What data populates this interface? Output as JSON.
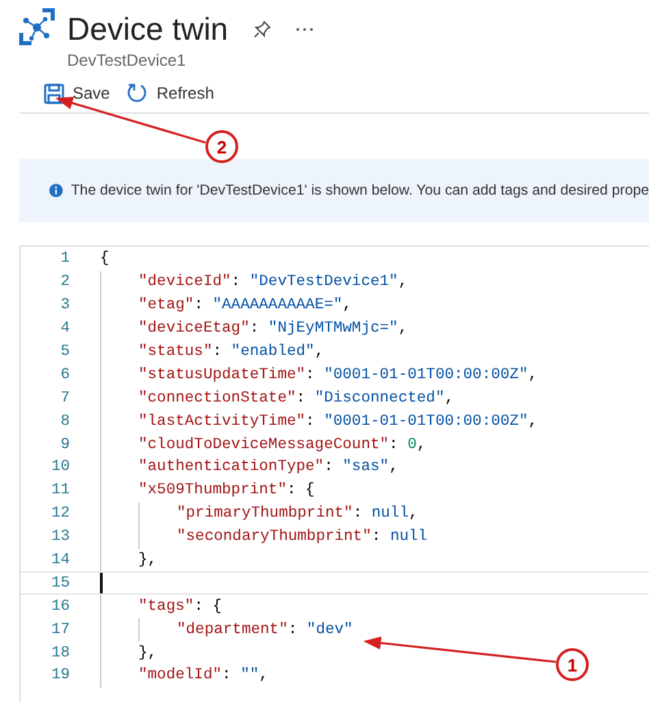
{
  "header": {
    "title": "Device twin",
    "subtitle": "DevTestDevice1"
  },
  "toolbar": [
    {
      "kind": "save",
      "label": "Save"
    },
    {
      "kind": "refresh",
      "label": "Refresh"
    }
  ],
  "info_banner": {
    "text": "The device twin for 'DevTestDevice1' is shown below. You can add tags and desired prope"
  },
  "editor": {
    "lines": [
      {
        "number": "1",
        "current": false,
        "tokens": [
          {
            "kind": "punct",
            "text": "{"
          }
        ],
        "children": [
          {
            "number": "2",
            "current": false,
            "tokens": [
              {
                "kind": "key",
                "text": "\"deviceId\""
              },
              {
                "kind": "punct",
                "text": ": "
              },
              {
                "kind": "string",
                "text": "\"DevTestDevice1\""
              },
              {
                "kind": "punct",
                "text": ","
              }
            ]
          },
          {
            "number": "3",
            "current": false,
            "tokens": [
              {
                "kind": "key",
                "text": "\"etag\""
              },
              {
                "kind": "punct",
                "text": ": "
              },
              {
                "kind": "string",
                "text": "\"AAAAAAAAAAE=\""
              },
              {
                "kind": "punct",
                "text": ","
              }
            ]
          },
          {
            "number": "4",
            "current": false,
            "tokens": [
              {
                "kind": "key",
                "text": "\"deviceEtag\""
              },
              {
                "kind": "punct",
                "text": ": "
              },
              {
                "kind": "string",
                "text": "\"NjEyMTMwMjc=\""
              },
              {
                "kind": "punct",
                "text": ","
              }
            ]
          },
          {
            "number": "5",
            "current": false,
            "tokens": [
              {
                "kind": "key",
                "text": "\"status\""
              },
              {
                "kind": "punct",
                "text": ": "
              },
              {
                "kind": "string",
                "text": "\"enabled\""
              },
              {
                "kind": "punct",
                "text": ","
              }
            ]
          },
          {
            "number": "6",
            "current": false,
            "tokens": [
              {
                "kind": "key",
                "text": "\"statusUpdateTime\""
              },
              {
                "kind": "punct",
                "text": ": "
              },
              {
                "kind": "string",
                "text": "\"0001-01-01T00:00:00Z\""
              },
              {
                "kind": "punct",
                "text": ","
              }
            ]
          },
          {
            "number": "7",
            "current": false,
            "tokens": [
              {
                "kind": "key",
                "text": "\"connectionState\""
              },
              {
                "kind": "punct",
                "text": ": "
              },
              {
                "kind": "string",
                "text": "\"Disconnected\""
              },
              {
                "kind": "punct",
                "text": ","
              }
            ]
          },
          {
            "number": "8",
            "current": false,
            "tokens": [
              {
                "kind": "key",
                "text": "\"lastActivityTime\""
              },
              {
                "kind": "punct",
                "text": ": "
              },
              {
                "kind": "string",
                "text": "\"0001-01-01T00:00:00Z\""
              },
              {
                "kind": "punct",
                "text": ","
              }
            ]
          },
          {
            "number": "9",
            "current": false,
            "tokens": [
              {
                "kind": "key",
                "text": "\"cloudToDeviceMessageCount\""
              },
              {
                "kind": "punct",
                "text": ": "
              },
              {
                "kind": "number",
                "text": "0"
              },
              {
                "kind": "punct",
                "text": ","
              }
            ]
          },
          {
            "number": "10",
            "current": false,
            "tokens": [
              {
                "kind": "key",
                "text": "\"authenticationType\""
              },
              {
                "kind": "punct",
                "text": ": "
              },
              {
                "kind": "string",
                "text": "\"sas\""
              },
              {
                "kind": "punct",
                "text": ","
              }
            ]
          },
          {
            "number": "11",
            "current": false,
            "tokens": [
              {
                "kind": "key",
                "text": "\"x509Thumbprint\""
              },
              {
                "kind": "punct",
                "text": ": {"
              }
            ],
            "children": [
              {
                "number": "12",
                "current": false,
                "tokens": [
                  {
                    "kind": "key",
                    "text": "\"primaryThumbprint\""
                  },
                  {
                    "kind": "punct",
                    "text": ": "
                  },
                  {
                    "kind": "null",
                    "text": "null"
                  },
                  {
                    "kind": "punct",
                    "text": ","
                  }
                ]
              },
              {
                "number": "13",
                "current": false,
                "tokens": [
                  {
                    "kind": "key",
                    "text": "\"secondaryThumbprint\""
                  },
                  {
                    "kind": "punct",
                    "text": ": "
                  },
                  {
                    "kind": "null",
                    "text": "null"
                  }
                ]
              }
            ]
          },
          {
            "number": "14",
            "current": false,
            "tokens": [
              {
                "kind": "punct",
                "text": "},"
              }
            ]
          },
          {
            "number": "15",
            "current": true
          },
          {
            "number": "16",
            "current": false,
            "tokens": [
              {
                "kind": "key",
                "text": "\"tags\""
              },
              {
                "kind": "punct",
                "text": ": {"
              }
            ],
            "children": [
              {
                "number": "17",
                "current": false,
                "tokens": [
                  {
                    "kind": "key",
                    "text": "\"department\""
                  },
                  {
                    "kind": "punct",
                    "text": ": "
                  },
                  {
                    "kind": "string",
                    "text": "\"dev\""
                  }
                ]
              }
            ]
          },
          {
            "number": "18",
            "current": false,
            "tokens": [
              {
                "kind": "punct",
                "text": "},"
              }
            ]
          },
          {
            "number": "19",
            "current": false,
            "tokens": [
              {
                "kind": "key",
                "text": "\"modelId\""
              },
              {
                "kind": "punct",
                "text": ": "
              },
              {
                "kind": "string",
                "text": "\"\""
              },
              {
                "kind": "punct",
                "text": ","
              }
            ]
          }
        ]
      }
    ]
  },
  "callouts": [
    {
      "label": "2"
    },
    {
      "label": "1"
    }
  ]
}
